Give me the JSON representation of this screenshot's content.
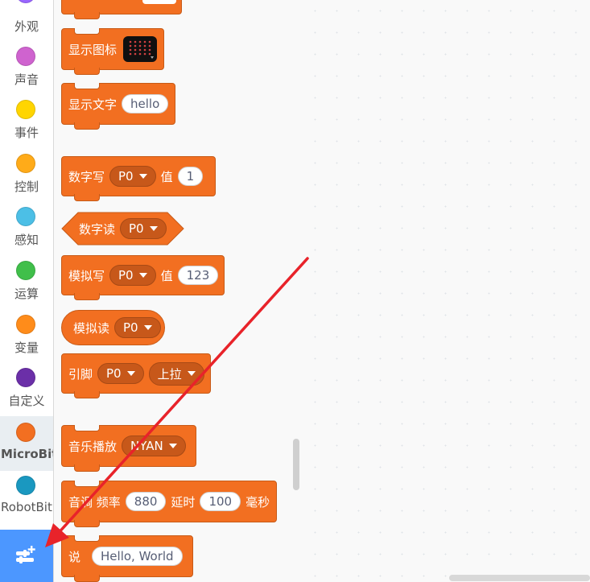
{
  "sidebar": {
    "categories": [
      {
        "label": "外观",
        "color": "#9966ff",
        "selected": false
      },
      {
        "label": "声音",
        "color": "#cf63cf",
        "selected": false
      },
      {
        "label": "事件",
        "color": "#ffd500",
        "selected": false
      },
      {
        "label": "控制",
        "color": "#ffab19",
        "selected": false
      },
      {
        "label": "感知",
        "color": "#4cbfe6",
        "selected": false
      },
      {
        "label": "运算",
        "color": "#40bf4a",
        "selected": false
      },
      {
        "label": "变量",
        "color": "#ff8c1a",
        "selected": false
      },
      {
        "label": "自定义",
        "color": "#6b2fa8",
        "selected": false
      },
      {
        "label": "MicroBit",
        "color": "#f26f21",
        "selected": true
      },
      {
        "label": "RobotBit",
        "color": "#1a98c0",
        "selected": false
      }
    ],
    "extension_button_icon": "add-extension-icon"
  },
  "blocks": {
    "show_icon": {
      "label": "显示图标"
    },
    "show_text": {
      "label": "显示文字",
      "value": "hello"
    },
    "digital_write": {
      "label": "数字写",
      "pin": "P0",
      "value_label": "值",
      "value": "1"
    },
    "digital_read": {
      "label": "数字读",
      "pin": "P0"
    },
    "analog_write": {
      "label": "模拟写",
      "pin": "P0",
      "value_label": "值",
      "value": "123"
    },
    "analog_read": {
      "label": "模拟读",
      "pin": "P0"
    },
    "pin_pull": {
      "label": "引脚",
      "pin": "P0",
      "mode": "上拉"
    },
    "play_music": {
      "label": "音乐播放",
      "melody": "NYAN"
    },
    "play_tone": {
      "label": "音调 频率",
      "freq": "880",
      "delay_label": "延时",
      "delay": "100",
      "unit": "毫秒"
    },
    "say": {
      "label": "说",
      "value": "Hello, World"
    }
  },
  "colors": {
    "microbit": "#f26f21",
    "microbit_dark": "#c7581a",
    "annotation_arrow": "#e8232a",
    "extension_button": "#4c97ff"
  }
}
